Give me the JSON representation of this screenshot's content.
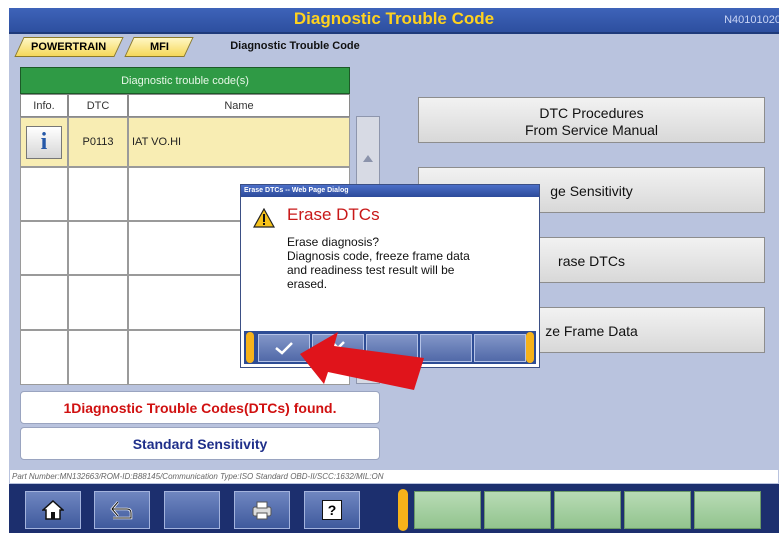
{
  "window": {
    "title": "Diagnostic Trouble Code",
    "screen_code": "N40101020"
  },
  "breadcrumb": {
    "items": [
      "POWERTRAIN",
      "MFI"
    ],
    "current": "Diagnostic Trouble Code"
  },
  "table": {
    "caption": "Diagnostic trouble code(s)",
    "headers": {
      "info": "Info.",
      "dtc": "DTC",
      "name": "Name"
    },
    "rows": [
      {
        "info_glyph": "i",
        "dtc": "P0113",
        "name": "IAT VO.HI"
      }
    ]
  },
  "side_buttons": {
    "procedures_line1": "DTC Procedures",
    "procedures_line2": "From Service Manual",
    "sensitivity": "ge Sensitivity",
    "erase": "rase DTCs",
    "freeze": "ze Frame Data"
  },
  "status": {
    "found": "1Diagnostic Trouble Codes(DTCs) found.",
    "sensitivity": "Standard Sensitivity",
    "found_color": "#d01010",
    "sensitivity_color": "#1f2f8a"
  },
  "part_number": "Part Number:MN132663/ROM-ID:B88145/Communication Type:ISO Standard OBD-II/SCC:1632/MIL:ON",
  "dialog": {
    "window_title": "Erase DTCs -- Web Page Dialog",
    "heading": "Erase DTCs",
    "message_lines": [
      "Erase diagnosis?",
      "Diagnosis code, freeze frame data",
      "and readiness test result will be",
      "erased."
    ],
    "buttons": [
      "ok-check-icon",
      "cancel-x-icon"
    ]
  },
  "footer": {
    "icons": [
      "home-icon",
      "back-arrow-icon",
      "print-icon",
      "help-icon"
    ],
    "help_glyph": "?"
  },
  "colors": {
    "title_text": "#ffd21e",
    "accent_yellow": "#f6b21a",
    "panel_bg": "#b9c3de",
    "arrow": "#e0141b"
  }
}
